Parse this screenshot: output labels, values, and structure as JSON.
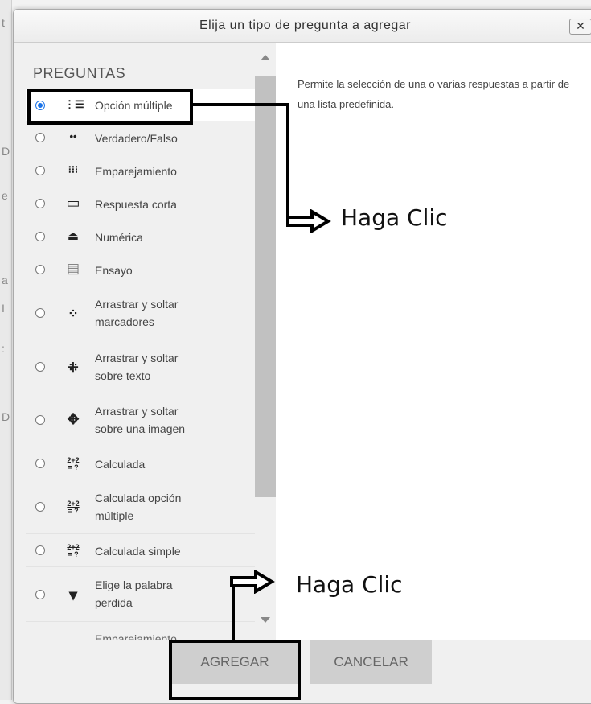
{
  "dialog": {
    "title": "Elija un tipo de pregunta a agregar",
    "close_label": "✕"
  },
  "left_pane": {
    "heading": "PREGUNTAS",
    "options": [
      {
        "icon": "list-icon",
        "glyph": "⋮☰",
        "label": "Opción múltiple",
        "selected": true
      },
      {
        "icon": "two-dots-icon",
        "glyph": "••",
        "label": "Verdadero/Falso",
        "selected": false
      },
      {
        "icon": "match-grid-icon",
        "glyph": "⁝⁝⁝",
        "label": "Emparejamiento",
        "selected": false
      },
      {
        "icon": "short-box-icon",
        "glyph": "▭",
        "label": "Respuesta corta",
        "selected": false
      },
      {
        "icon": "numeric-icon",
        "glyph": "⏏",
        "label": "Numérica",
        "selected": false
      },
      {
        "icon": "essay-icon",
        "glyph": "▤",
        "label": "Ensayo",
        "selected": false
      },
      {
        "icon": "drag-markers-icon",
        "glyph": "⁘",
        "label": "Arrastrar y soltar marcadores",
        "label_line1": "Arrastrar y soltar",
        "label_line2": "marcadores",
        "selected": false
      },
      {
        "icon": "drag-text-icon",
        "glyph": "⁜",
        "label": "Arrastrar y soltar sobre texto",
        "label_line1": "Arrastrar y soltar",
        "label_line2": "sobre texto",
        "selected": false
      },
      {
        "icon": "drag-image-icon",
        "glyph": "✥",
        "label": "Arrastrar y soltar sobre una imagen",
        "label_line1": "Arrastrar y soltar",
        "label_line2": "sobre una imagen",
        "selected": false
      },
      {
        "icon": "calculated-icon",
        "glyph_top": "2+2",
        "glyph_bottom": "= ?",
        "label": "Calculada",
        "selected": false
      },
      {
        "icon": "calculated-multi-icon",
        "glyph_top": "2+2",
        "glyph_bottom": "= ?",
        "label": "Calculada opción múltiple",
        "label_line1": "Calculada opción",
        "label_line2": "múltiple",
        "selected": false
      },
      {
        "icon": "calculated-simple-icon",
        "glyph_top": "2+2",
        "glyph_bottom": "= ?",
        "label": "Calculada simple",
        "selected": false
      },
      {
        "icon": "caret-down-icon",
        "glyph": "▾",
        "label": "Elige la palabra perdida",
        "label_line1": "Elige la palabra",
        "label_line2": "perdida",
        "selected": false
      },
      {
        "icon": "partial-icon",
        "label": "Emparejamiento",
        "selected": false
      }
    ]
  },
  "description": "Permite la selección de una o varias respuestas a partir de una lista predefinida.",
  "buttons": {
    "add": "AGREGAR",
    "cancel": "CANCELAR"
  },
  "annotations": {
    "haga_clic_1": "Haga Clic",
    "haga_clic_2": "Haga Clic"
  },
  "background_chars": [
    "t",
    "D",
    "e",
    "a",
    "I",
    ":",
    "D"
  ]
}
